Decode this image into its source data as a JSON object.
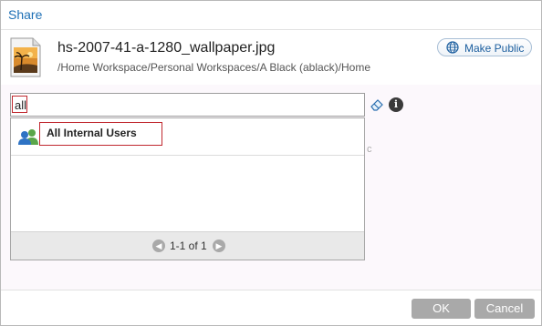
{
  "dialog": {
    "title": "Share"
  },
  "file": {
    "name": "hs-2007-41-a-1280_wallpaper.jpg",
    "path": "/Home Workspace/Personal Workspaces/A Black (ablack)/Home",
    "icon": "image-file-icon"
  },
  "make_public": {
    "label": "Make Public",
    "icon": "globe-icon"
  },
  "search": {
    "value": "all",
    "placeholder": ""
  },
  "stray_text": "c",
  "suggestions": [
    {
      "label": "All Internal Users",
      "icon": "users-group-icon"
    }
  ],
  "pager": {
    "text": "1-1 of 1",
    "prev": "◀",
    "next": "▶"
  },
  "info_glyph": "i",
  "buttons": {
    "ok": "OK",
    "cancel": "Cancel"
  },
  "colors": {
    "accent": "#1d6fb5",
    "highlight": "#c0282f",
    "button": "#a9a9a9"
  }
}
